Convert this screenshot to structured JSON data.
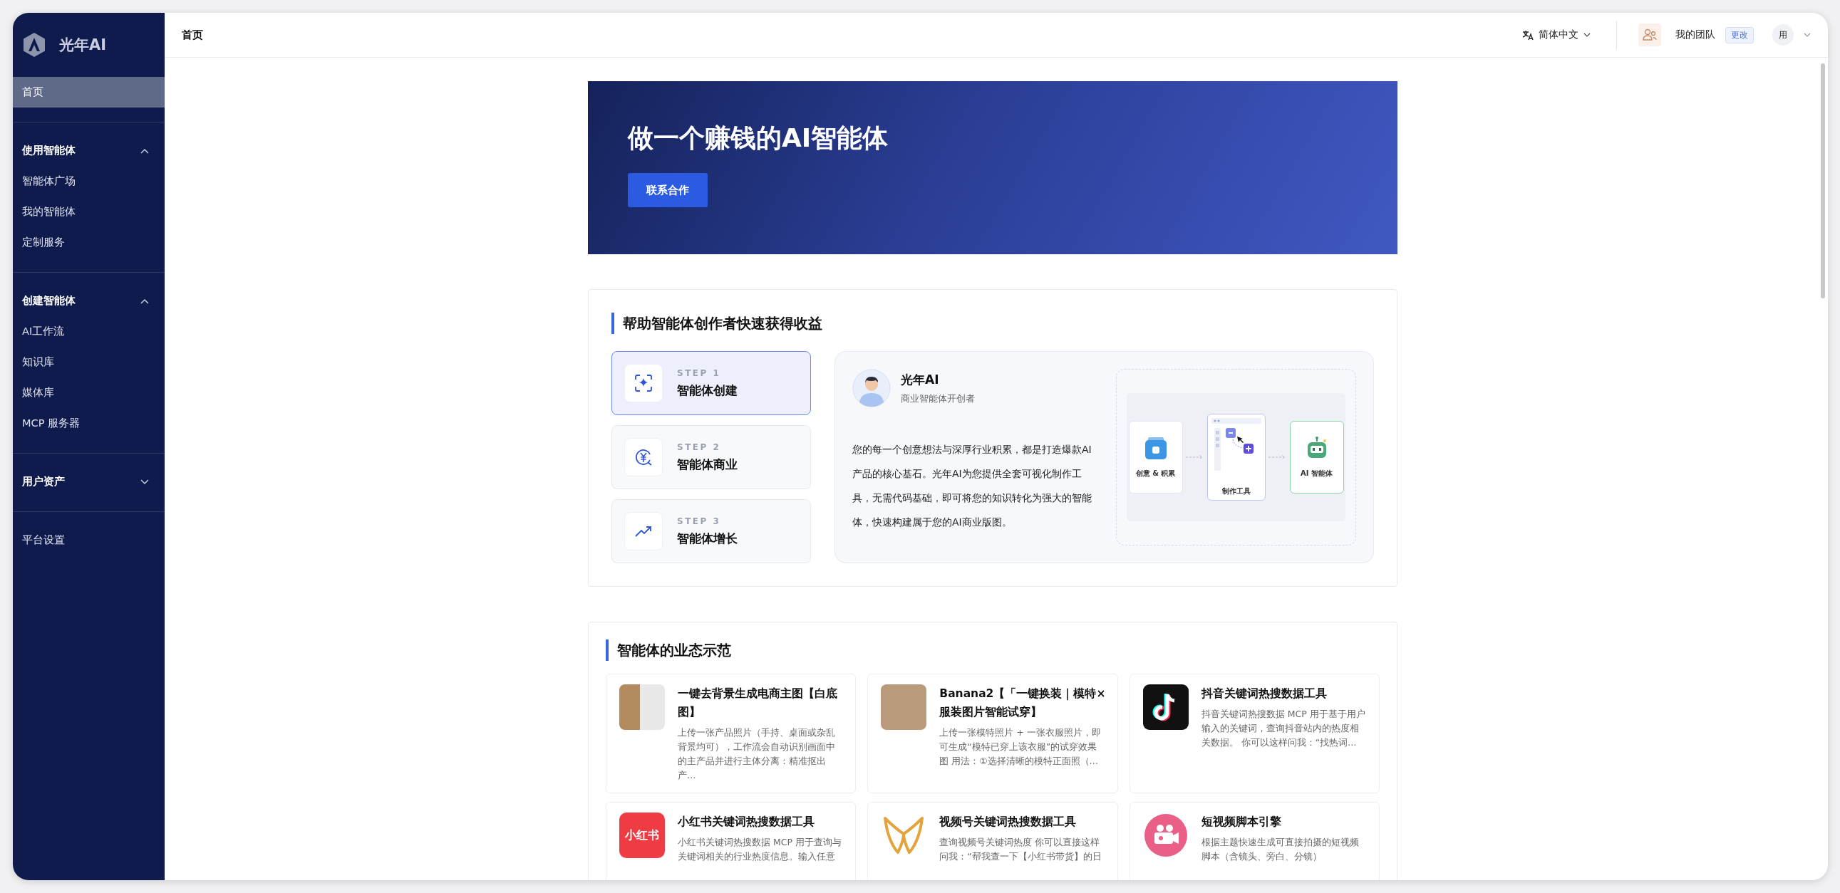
{
  "app": {
    "logo_text": "光年AI"
  },
  "sidebar": {
    "items": [
      {
        "kind": "link",
        "label": "首页",
        "selected": true
      },
      {
        "kind": "group",
        "label": "使用智能体",
        "expanded": true,
        "children": [
          {
            "label": "智能体广场",
            "selected": false
          },
          {
            "label": "我的智能体",
            "selected": false
          },
          {
            "label": "定制服务",
            "selected": false
          }
        ]
      },
      {
        "kind": "group",
        "label": "创建智能体",
        "expanded": true,
        "children": [
          {
            "label": "AI工作流",
            "selected": false
          },
          {
            "label": "知识库",
            "selected": false
          },
          {
            "label": "媒体库",
            "selected": false
          },
          {
            "label": "MCP 服务器",
            "selected": false
          }
        ]
      },
      {
        "kind": "group",
        "label": "用户资产",
        "expanded": false
      },
      {
        "kind": "link",
        "label": "平台设置",
        "selected": false
      }
    ]
  },
  "topbar": {
    "title": "首页",
    "language": "简体中文",
    "team": "我的团队",
    "team_action": "更改",
    "avatar_text": "用"
  },
  "banner": {
    "title": "做一个赚钱的AI智能体",
    "button": "联系合作"
  },
  "steps_section": {
    "title": "帮助智能体创作者快速获得收益",
    "steps": [
      {
        "kind": "create",
        "step": "STEP 1",
        "label": "智能体创建",
        "selected": true
      },
      {
        "kind": "commerce",
        "step": "STEP 2",
        "label": "智能体商业",
        "selected": false
      },
      {
        "kind": "growth",
        "step": "STEP 3",
        "label": "智能体增长",
        "selected": false
      }
    ],
    "intro": {
      "name": "光年AI",
      "role": "商业智能体开创者",
      "text": "您的每一个创意想法与深厚行业积累，都是打造爆款AI产品的核心基石。光年AI为您提供全套可视化制作工具，无需代码基础，即可将您的知识转化为强大的智能体，快速构建属于您的AI商业版图。"
    },
    "diagram": {
      "labels": [
        "创意 & 积累",
        "制作工具",
        "AI 智能体"
      ]
    }
  },
  "showcase": {
    "title": "智能体的业态示范",
    "cards": [
      {
        "kind": "product_photo",
        "title": "一键去背景生成电商主图【白底图】",
        "description": "上传一张产品照片（手持、桌面或杂乱背景均可），工作流会自动识别画面中的主产品并进行主体分离：精准抠出产…"
      },
      {
        "kind": "people_photo",
        "title": "Banana2【「一键换装｜模特×服装图片智能试穿】",
        "description": "上传一张模特照片 + 一张衣服照片，即可生成“模特已穿上该衣服”的试穿效果图 用法：①选择清晰的模特正面照（…"
      },
      {
        "kind": "tiktok",
        "title": "抖音关键词热搜数据工具",
        "description": "抖音关键词热搜数据 MCP 用于基于用户输入的关键词，查询抖音站内的热度相关数据。 你可以这样问我：“找热词…"
      },
      {
        "kind": "xiaohongshu",
        "logo_text": "小红书",
        "title": "小红书关键词热搜数据工具",
        "description": "小红书关键词热搜数据 MCP 用于查询与关键词相关的行业热度信息。输入任意"
      },
      {
        "kind": "channels",
        "title": "视频号关键词热搜数据工具",
        "description": "查询视频号关键词热度 你可以直接这样问我：“帮我查一下【小红书带货】的日"
      },
      {
        "kind": "video",
        "title": "短视频脚本引擎",
        "description": "根据主题快速生成可直接拍摄的短视频脚本（含镜头、旁白、分镜）"
      }
    ]
  }
}
